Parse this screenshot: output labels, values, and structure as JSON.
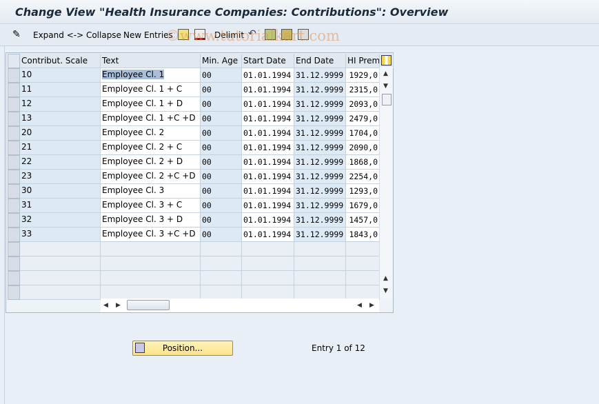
{
  "title": "Change View \"Health Insurance Companies: Contributions\": Overview",
  "watermark": "©www.tutorialkart.com",
  "toolbar": {
    "expand_collapse": "Expand <-> Collapse",
    "new_entries": "New Entries",
    "delimit": "Delimit"
  },
  "table": {
    "columns": [
      "Contribut. Scale",
      "Text",
      "Min. Age",
      "Start Date",
      "End Date",
      "HI Prem."
    ],
    "rows": [
      [
        "10",
        "Employee Cl. 1",
        "00",
        "01.01.1994",
        "31.12.9999",
        "1929,0"
      ],
      [
        "11",
        "Employee Cl. 1 + C",
        "00",
        "01.01.1994",
        "31.12.9999",
        "2315,0"
      ],
      [
        "12",
        "Employee Cl. 1 + D",
        "00",
        "01.01.1994",
        "31.12.9999",
        "2093,0"
      ],
      [
        "13",
        "Employee Cl. 1 +C +D",
        "00",
        "01.01.1994",
        "31.12.9999",
        "2479,0"
      ],
      [
        "20",
        "Employee Cl. 2",
        "00",
        "01.01.1994",
        "31.12.9999",
        "1704,0"
      ],
      [
        "21",
        "Employee Cl. 2 + C",
        "00",
        "01.01.1994",
        "31.12.9999",
        "2090,0"
      ],
      [
        "22",
        "Employee Cl. 2 + D",
        "00",
        "01.01.1994",
        "31.12.9999",
        "1868,0"
      ],
      [
        "23",
        "Employee Cl. 2 +C +D",
        "00",
        "01.01.1994",
        "31.12.9999",
        "2254,0"
      ],
      [
        "30",
        "Employee Cl. 3",
        "00",
        "01.01.1994",
        "31.12.9999",
        "1293,0"
      ],
      [
        "31",
        "Employee Cl. 3 + C",
        "00",
        "01.01.1994",
        "31.12.9999",
        "1679,0"
      ],
      [
        "32",
        "Employee Cl. 3 + D",
        "00",
        "01.01.1994",
        "31.12.9999",
        "1457,0"
      ],
      [
        "33",
        "Employee Cl. 3 +C +D",
        "00",
        "01.01.1994",
        "31.12.9999",
        "1843,0"
      ]
    ],
    "empty_rows": 4
  },
  "footer": {
    "position_button": "Position...",
    "entry_text": "Entry 1 of 12"
  }
}
